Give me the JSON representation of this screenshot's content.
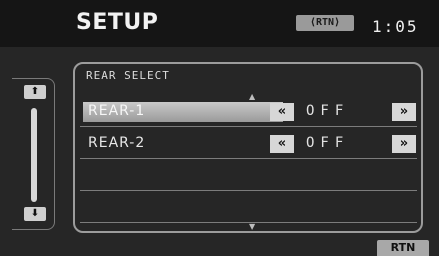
{
  "header": {
    "title": "SETUP",
    "rtn_pill": "⟨RTN⟩",
    "clock": "1:05"
  },
  "scroll": {
    "up_icon": "double-up-arrow",
    "down_icon": "double-down-arrow",
    "up_glyph": "⬆",
    "down_glyph": "⬇"
  },
  "panel": {
    "title": "REAR SELECT",
    "rows": [
      {
        "label": "REAR-1",
        "value": "OFF",
        "left_glyph": "«",
        "right_glyph": "»"
      },
      {
        "label": "REAR-2",
        "value": "OFF",
        "left_glyph": "«",
        "right_glyph": "»"
      }
    ],
    "up_glyph": "▲",
    "down_glyph": "▼"
  },
  "footer": {
    "rtn_label": "RTN"
  },
  "colors": {
    "background": "#262626",
    "header": "#151515",
    "button": "#d7d7d7",
    "selection": "#b5b5b5"
  }
}
